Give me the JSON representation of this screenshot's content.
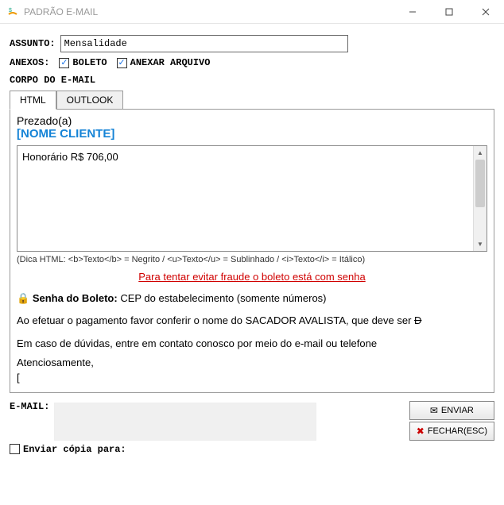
{
  "window": {
    "title": "PADRÃO E-MAIL"
  },
  "form": {
    "subject_label": "ASSUNTO:",
    "subject_value": "Mensalidade",
    "attach_label": "ANEXOS:",
    "checkbox_boleto": "BOLETO",
    "checkbox_anexar": "ANEXAR ARQUIVO",
    "body_label": "CORPO DO E-MAIL"
  },
  "tabs": {
    "html": "HTML",
    "outlook": "OUTLOOK"
  },
  "body": {
    "greeting": "Prezado(a)",
    "client_placeholder": "[NOME CLIENTE]",
    "editor_text": "Honorário R$ 706,00",
    "hint": "(Dica HTML: <b>Texto</b> = Negrito / <u>Texto</u> = Sublinhado / <i>Texto</i> = Itálico)",
    "warning": "Para tentar evitar fraude o boleto está com senha",
    "lock": "🔒",
    "senha_label": "Senha do Boleto:",
    "senha_desc": "CEP do estabelecimento (somente números)",
    "para1": "Ao efetuar o pagamento favor conferir o nome do SACADOR AVALISTA, que deve ser ",
    "para1_struck": "D",
    "para2": "Em caso de dúvidas, entre em contato conosco por meio do e-mail ou telefone",
    "atenciosamente": "Atenciosamente,",
    "bracket": "["
  },
  "bottom": {
    "email_label": "E-MAIL:",
    "btn_enviar": "ENVIAR",
    "btn_fechar": "FECHAR(ESC)",
    "copy_label": "Enviar cópia para:"
  },
  "icons": {
    "check": "✓",
    "envelope": "✉",
    "close_x": "✖"
  }
}
